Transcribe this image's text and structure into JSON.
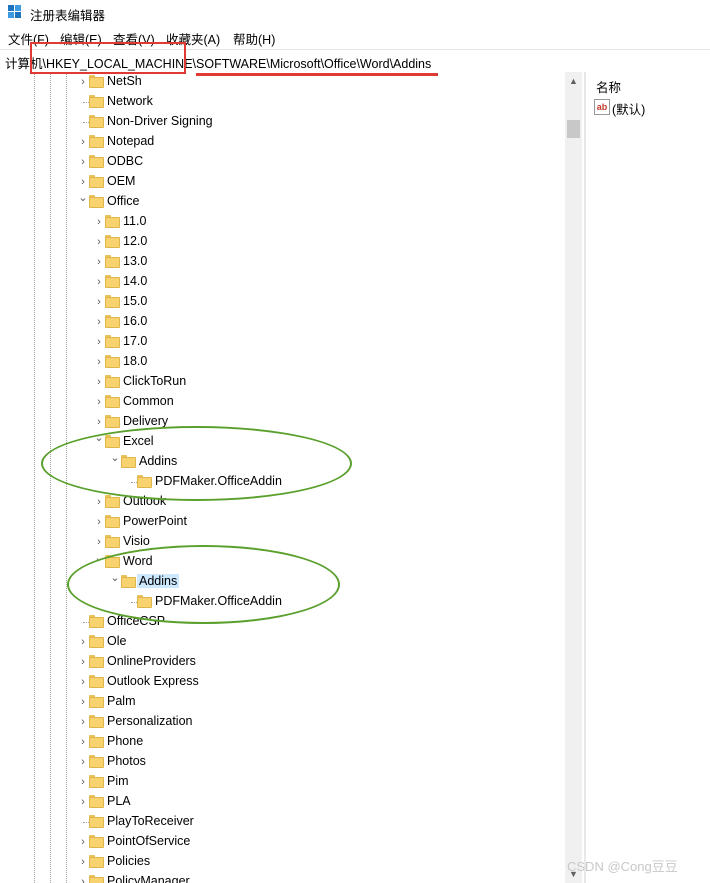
{
  "window": {
    "title": "注册表编辑器",
    "icon": "registry-editor-icon"
  },
  "menu": [
    {
      "label": "文件(F)"
    },
    {
      "label": "编辑(E)"
    },
    {
      "label": "查看(V)"
    },
    {
      "label": "收藏夹(A)"
    },
    {
      "label": "帮助(H)"
    }
  ],
  "address": {
    "path": "计算机\\HKEY_LOCAL_MACHINE\\SOFTWARE\\Microsoft\\Office\\Word\\Addins"
  },
  "tree": {
    "nodes": [
      {
        "label": "NetSh",
        "expander": "collapsed"
      },
      {
        "label": "Network",
        "expander": "none"
      },
      {
        "label": "Non-Driver Signing",
        "expander": "none"
      },
      {
        "label": "Notepad",
        "expander": "collapsed"
      },
      {
        "label": "ODBC",
        "expander": "collapsed"
      },
      {
        "label": "OEM",
        "expander": "collapsed"
      },
      {
        "label": "Office",
        "expander": "expanded"
      },
      {
        "label": "11.0",
        "expander": "collapsed"
      },
      {
        "label": "12.0",
        "expander": "collapsed"
      },
      {
        "label": "13.0",
        "expander": "collapsed"
      },
      {
        "label": "14.0",
        "expander": "collapsed"
      },
      {
        "label": "15.0",
        "expander": "collapsed"
      },
      {
        "label": "16.0",
        "expander": "collapsed"
      },
      {
        "label": "17.0",
        "expander": "collapsed"
      },
      {
        "label": "18.0",
        "expander": "collapsed"
      },
      {
        "label": "ClickToRun",
        "expander": "collapsed"
      },
      {
        "label": "Common",
        "expander": "collapsed"
      },
      {
        "label": "Delivery",
        "expander": "collapsed"
      },
      {
        "label": "Excel",
        "expander": "expanded"
      },
      {
        "label": "Addins",
        "expander": "expanded"
      },
      {
        "label": "PDFMaker.OfficeAddin",
        "expander": "none"
      },
      {
        "label": "Outlook",
        "expander": "collapsed"
      },
      {
        "label": "PowerPoint",
        "expander": "collapsed"
      },
      {
        "label": "Visio",
        "expander": "collapsed"
      },
      {
        "label": "Word",
        "expander": "expanded"
      },
      {
        "label": "Addins",
        "expander": "expanded",
        "selected": true
      },
      {
        "label": "PDFMaker.OfficeAddin",
        "expander": "none"
      },
      {
        "label": "OfficeCSP",
        "expander": "none"
      },
      {
        "label": "Ole",
        "expander": "collapsed"
      },
      {
        "label": "OnlineProviders",
        "expander": "collapsed"
      },
      {
        "label": "Outlook Express",
        "expander": "collapsed"
      },
      {
        "label": "Palm",
        "expander": "collapsed"
      },
      {
        "label": "Personalization",
        "expander": "collapsed"
      },
      {
        "label": "Phone",
        "expander": "collapsed"
      },
      {
        "label": "Photos",
        "expander": "collapsed"
      },
      {
        "label": "Pim",
        "expander": "collapsed"
      },
      {
        "label": "PLA",
        "expander": "collapsed"
      },
      {
        "label": "PlayToReceiver",
        "expander": "none"
      },
      {
        "label": "PointOfService",
        "expander": "collapsed"
      },
      {
        "label": "Policies",
        "expander": "collapsed"
      },
      {
        "label": "PolicyManager",
        "expander": "collapsed"
      }
    ]
  },
  "values": {
    "header": "名称",
    "rows": [
      {
        "icon": "string-value-icon",
        "icon_text": "ab",
        "name": "(默认)"
      }
    ]
  },
  "watermark": "CSDN @Cong豆豆",
  "colors": {
    "annotation_red": "#e03b32",
    "annotation_green": "#5aa02c",
    "selection": "#cce8ff",
    "folder": "#f7d26e"
  }
}
